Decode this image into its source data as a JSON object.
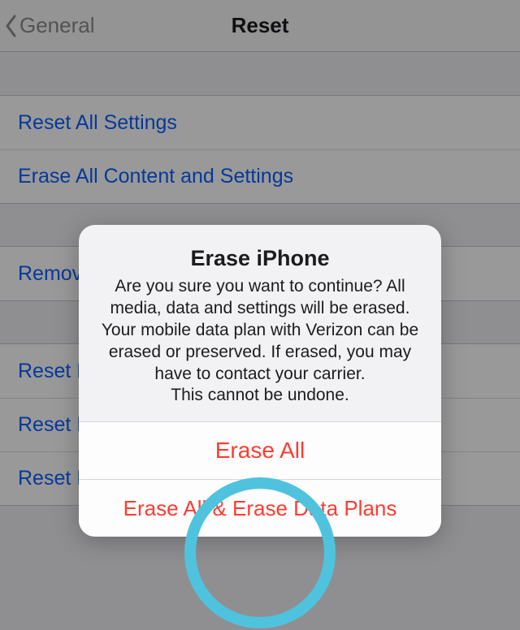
{
  "nav": {
    "back_label": "General",
    "title": "Reset"
  },
  "group1": [
    {
      "label": "Reset All Settings"
    },
    {
      "label": "Erase All Content and Settings"
    }
  ],
  "group2": [
    {
      "label": "Remove"
    }
  ],
  "group3": [
    {
      "label": "Reset K"
    },
    {
      "label": "Reset H"
    },
    {
      "label": "Reset L"
    }
  ],
  "alert": {
    "title": "Erase iPhone",
    "message": "Are you sure you want to continue? All media, data and settings will be erased. Your mobile data plan with Verizon can be erased or preserved. If erased, you may have to contact your carrier.\nThis cannot be undone.",
    "button1": "Erase All",
    "button2": "Erase All & Erase Data Plans"
  }
}
